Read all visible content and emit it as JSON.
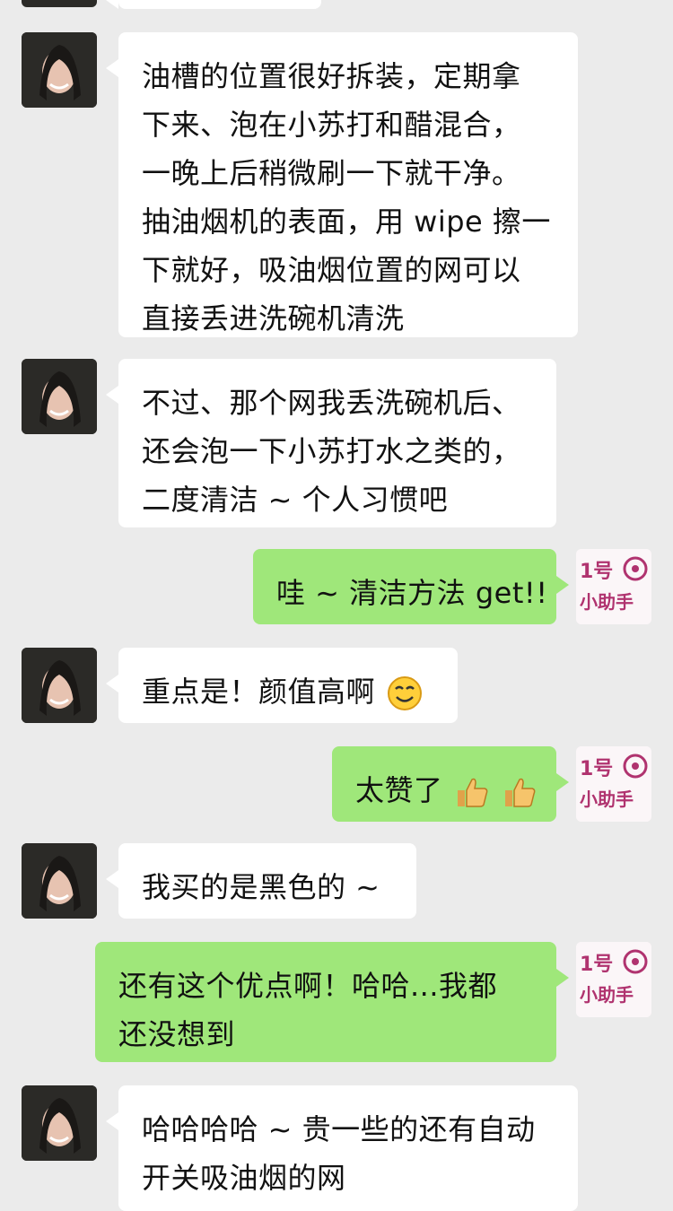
{
  "chat": {
    "messages": [
      {
        "side": "in",
        "lines": [
          ""
        ]
      },
      {
        "side": "in",
        "lines": [
          "油槽的位置很好拆装，定期拿",
          "下来、泡在小苏打和醋混合，",
          "一晚上后稍微刷一下就干净。",
          "抽油烟机的表面，用 wipe 擦一",
          "下就好，吸油烟位置的网可以",
          "直接丢进洗碗机清洗"
        ]
      },
      {
        "side": "in",
        "lines": [
          "不过、那个网我丢洗碗机后、",
          "还会泡一下小苏打水之类的，",
          "二度清洁 ~ 个人习惯吧"
        ]
      },
      {
        "side": "out",
        "text": "哇 ~ 清洁方法 get!!"
      },
      {
        "side": "in",
        "text": "重点是！颜值高啊",
        "emoji": "smile-face-icon"
      },
      {
        "side": "out",
        "text": "太赞了",
        "emoji": "thumbs-up-icon"
      },
      {
        "side": "in",
        "text": "我买的是黑色的 ~"
      },
      {
        "side": "out",
        "lines": [
          "还有这个优点啊！哈哈...我都",
          "还没想到"
        ]
      },
      {
        "side": "in",
        "lines": [
          "哈哈哈哈 ~ 贵一些的还有自动",
          "开关吸油烟的网"
        ]
      }
    ],
    "assistant_avatar": {
      "line1": "1号",
      "line2": "小助手",
      "color": "#b0336f"
    }
  }
}
